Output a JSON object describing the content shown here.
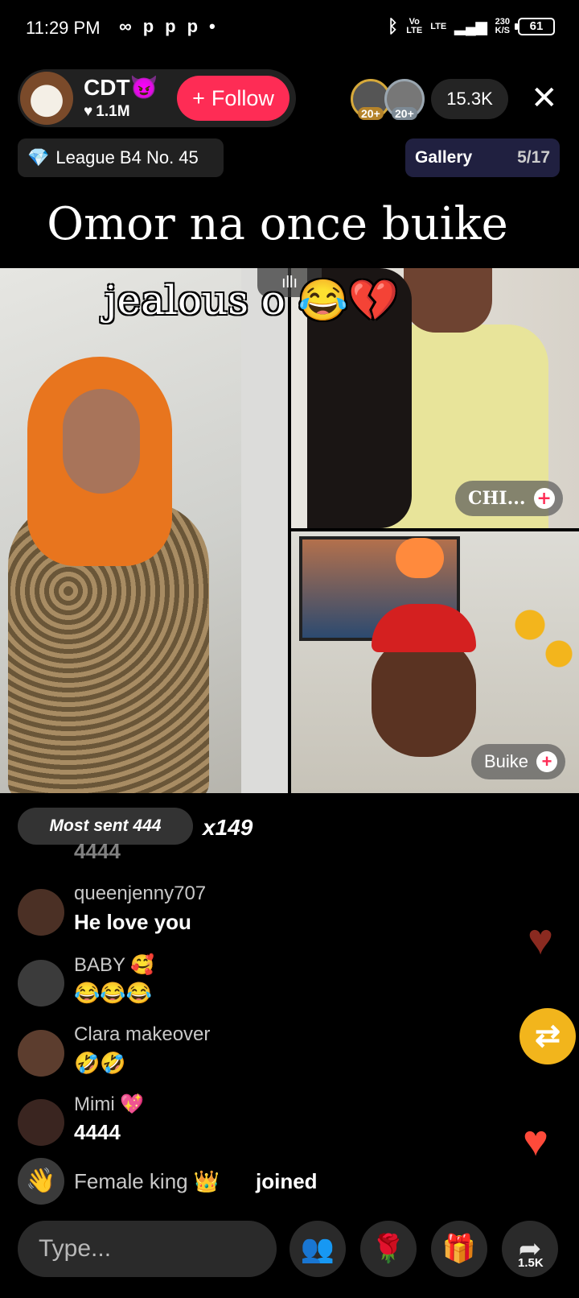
{
  "status_bar": {
    "time": "11:29 PM",
    "notif_icons": [
      "∞",
      "p",
      "p",
      "p",
      "•"
    ],
    "net_vo": "Vo",
    "net_lte": "LTE",
    "net_lte2": "LTE",
    "speed_value": "230",
    "speed_unit": "K/S",
    "battery": "61"
  },
  "host": {
    "name": "CDT😈",
    "likes": "1.1M",
    "follow_label": "Follow",
    "follow_plus": "+"
  },
  "viewers": {
    "badge_1": "20+",
    "badge_2": "20+",
    "count": "15.3K"
  },
  "close_label": "✕",
  "league": {
    "icon": "💎",
    "label": "League B4 No. 45"
  },
  "gallery": {
    "label": "Gallery",
    "count": "5/17"
  },
  "caption_title": "Omor na once buike",
  "overlay_text": "jealous o 😂💔",
  "sound_icon": "ıllı",
  "guests": [
    {
      "name": "CHI...",
      "plus": "+"
    },
    {
      "name": "Buike",
      "plus": "+"
    }
  ],
  "gift_banner": {
    "label": "Most sent 444",
    "multiplier": "x149"
  },
  "faded_comment": "4444",
  "comments": [
    {
      "user": "queenjenny707",
      "message": "He love you"
    },
    {
      "user": "BABY 🥰",
      "message": "😂😂😂"
    },
    {
      "user": "Clara makeover",
      "message": "🤣🤣"
    },
    {
      "user": "Mimi 💖",
      "message": "4444"
    }
  ],
  "join_event": {
    "user": "Female king 👑",
    "action": "joined",
    "icon": "👋"
  },
  "floating": {
    "heart": "♥",
    "repost": "⇄"
  },
  "bottom_bar": {
    "placeholder": "Type...",
    "guests_icon": "👥",
    "rose_icon": "🌹",
    "gift_icon": "🎁",
    "share_icon": "➦",
    "share_count": "1.5K"
  },
  "colors": {
    "follow": "#fe2c55",
    "accent_gold": "#f2b51c",
    "background": "#000000"
  }
}
